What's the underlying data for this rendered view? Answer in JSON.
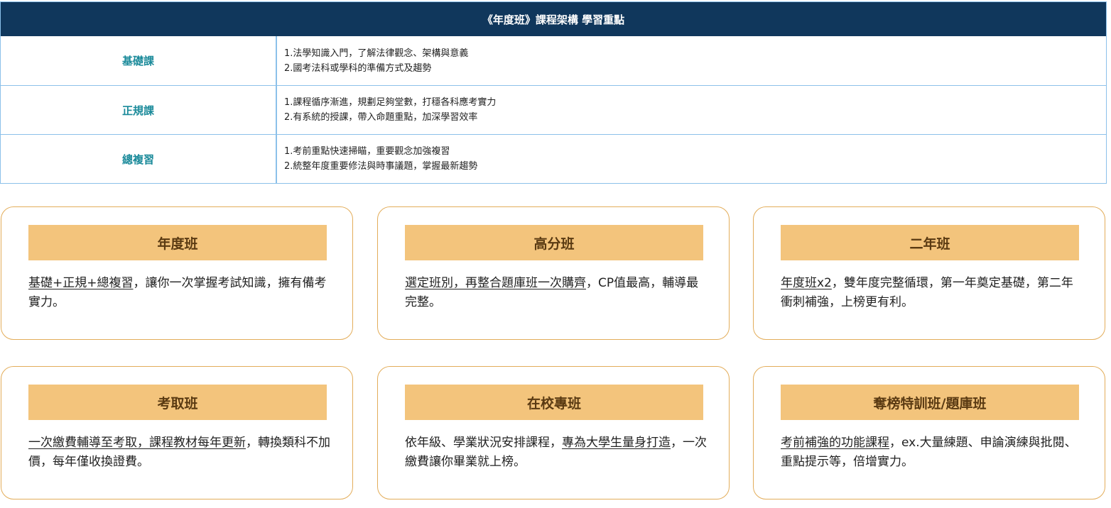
{
  "table": {
    "header": "《年度班》課程架構 學習重點",
    "rows": [
      {
        "label": "基礎課",
        "lines": [
          "1.法學知識入門，了解法律觀念、架構與意義",
          "2.國考法科或學科的準備方式及趨勢"
        ]
      },
      {
        "label": "正規課",
        "lines": [
          "1.課程循序漸進，規劃足夠堂數，打穩各科應考實力",
          "2.有系統的授課，帶入命題重點，加深學習效率"
        ]
      },
      {
        "label": "總複習",
        "lines": [
          "1.考前重點快速掃瞄，重要觀念加強複習",
          "2.統整年度重要修法與時事議題，掌握最新趨勢"
        ]
      }
    ]
  },
  "cards": [
    {
      "title": "年度班",
      "pre": "",
      "highlight": "基礎+正規+總複習",
      "post": "，讓你一次掌握考試知識，擁有備考實力。"
    },
    {
      "title": "高分班",
      "pre": "",
      "highlight": "選定班別，再整合題庫班一次購齊",
      "post": "，CP值最高，輔導最完整。"
    },
    {
      "title": "二年班",
      "pre": "",
      "highlight": "年度班x2",
      "post": "，雙年度完整循環，第一年奠定基礎，第二年衝刺補強，上榜更有利。"
    },
    {
      "title": "考取班",
      "pre": "",
      "highlight": "一次繳費輔導至考取，課程教材每年更新",
      "post": "，轉換類科不加價，每年僅收換證費。"
    },
    {
      "title": "在校專班",
      "pre": "依年級、學業狀況安排課程，",
      "highlight": "專為大學生量身打造",
      "post": "，一次繳費讓你畢業就上榜。"
    },
    {
      "title": "奪榜特訓班/題庫班",
      "pre": "",
      "highlight": "考前補強的功能課程",
      "post": "，ex.大量練題、申論演練與批閱、重點提示等，倍增實力。"
    }
  ]
}
